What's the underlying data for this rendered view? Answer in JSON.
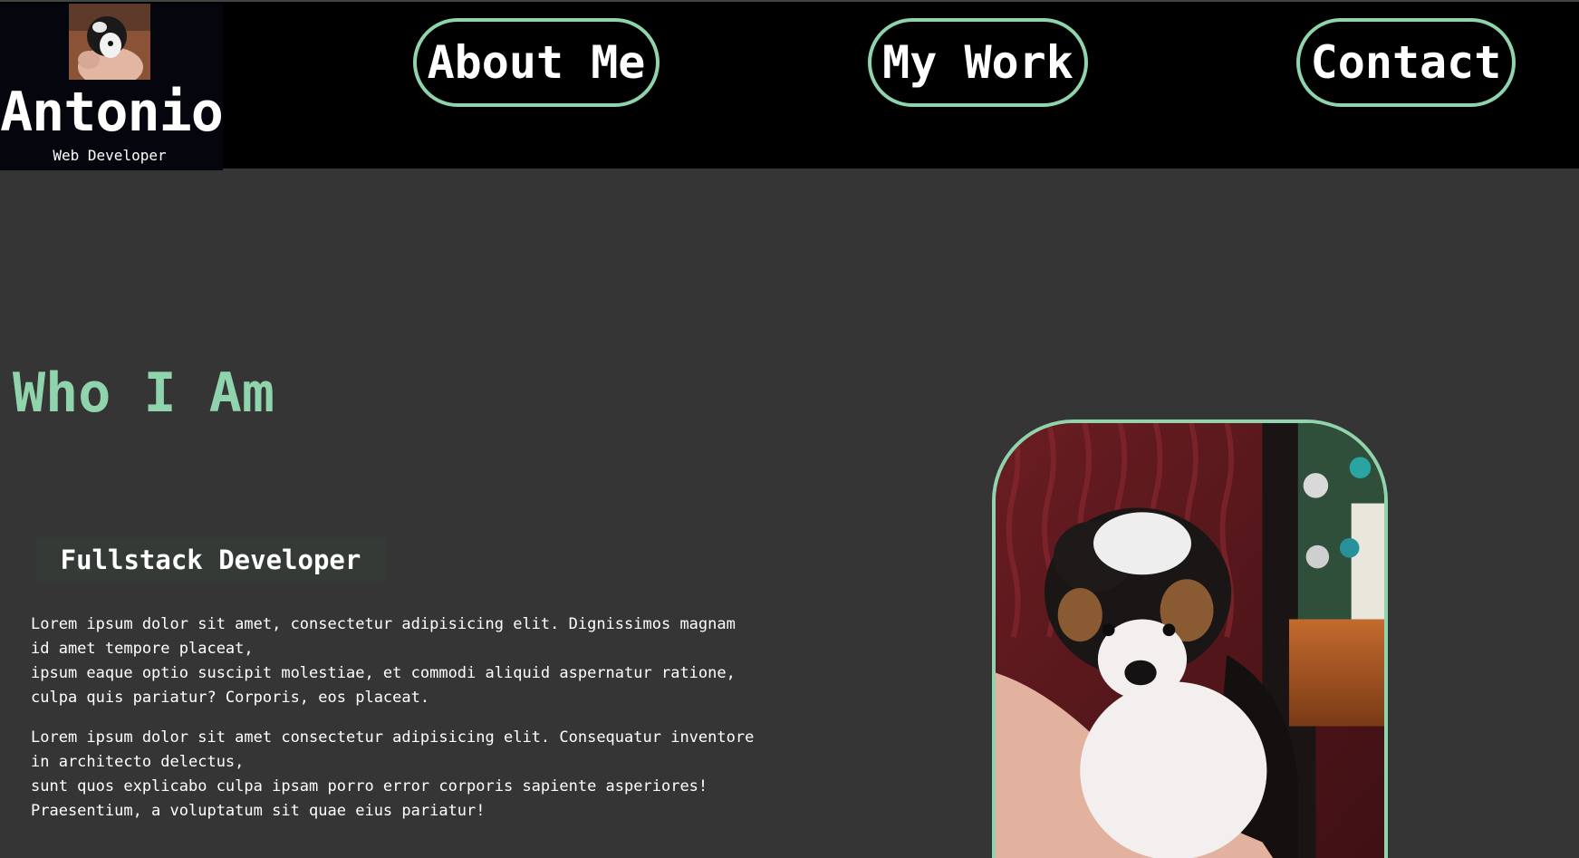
{
  "brand": {
    "name": "Antonio",
    "role": "Web Developer"
  },
  "nav": {
    "about": "About Me",
    "work": "My Work",
    "contact": "Contact"
  },
  "main": {
    "section_title": "Who I Am",
    "subtitle": "Fullstack Developer",
    "paragraph_1": [
      "Lorem ipsum dolor sit amet, consectetur adipisicing elit. Dignissimos magnam",
      "id amet tempore placeat,",
      "ipsum eaque optio suscipit molestiae, et commodi aliquid aspernatur ratione,",
      "culpa quis pariatur? Corporis, eos placeat."
    ],
    "paragraph_2": [
      "Lorem ipsum dolor sit amet consectetur adipisicing elit. Consequatur inventore",
      "in architecto delectus,",
      "sunt quos explicabo culpa ipsam porro error corporis sapiente asperiores!",
      "Praesentium, a voluptatum sit quae eius pariatur!"
    ]
  },
  "colors": {
    "accent": "#8fd4ac",
    "header_bg": "#000000",
    "page_bg": "#353535",
    "text": "#ffffff"
  },
  "icons": {
    "avatar": "puppy-photo",
    "profile_photo": "puppy-photo"
  }
}
